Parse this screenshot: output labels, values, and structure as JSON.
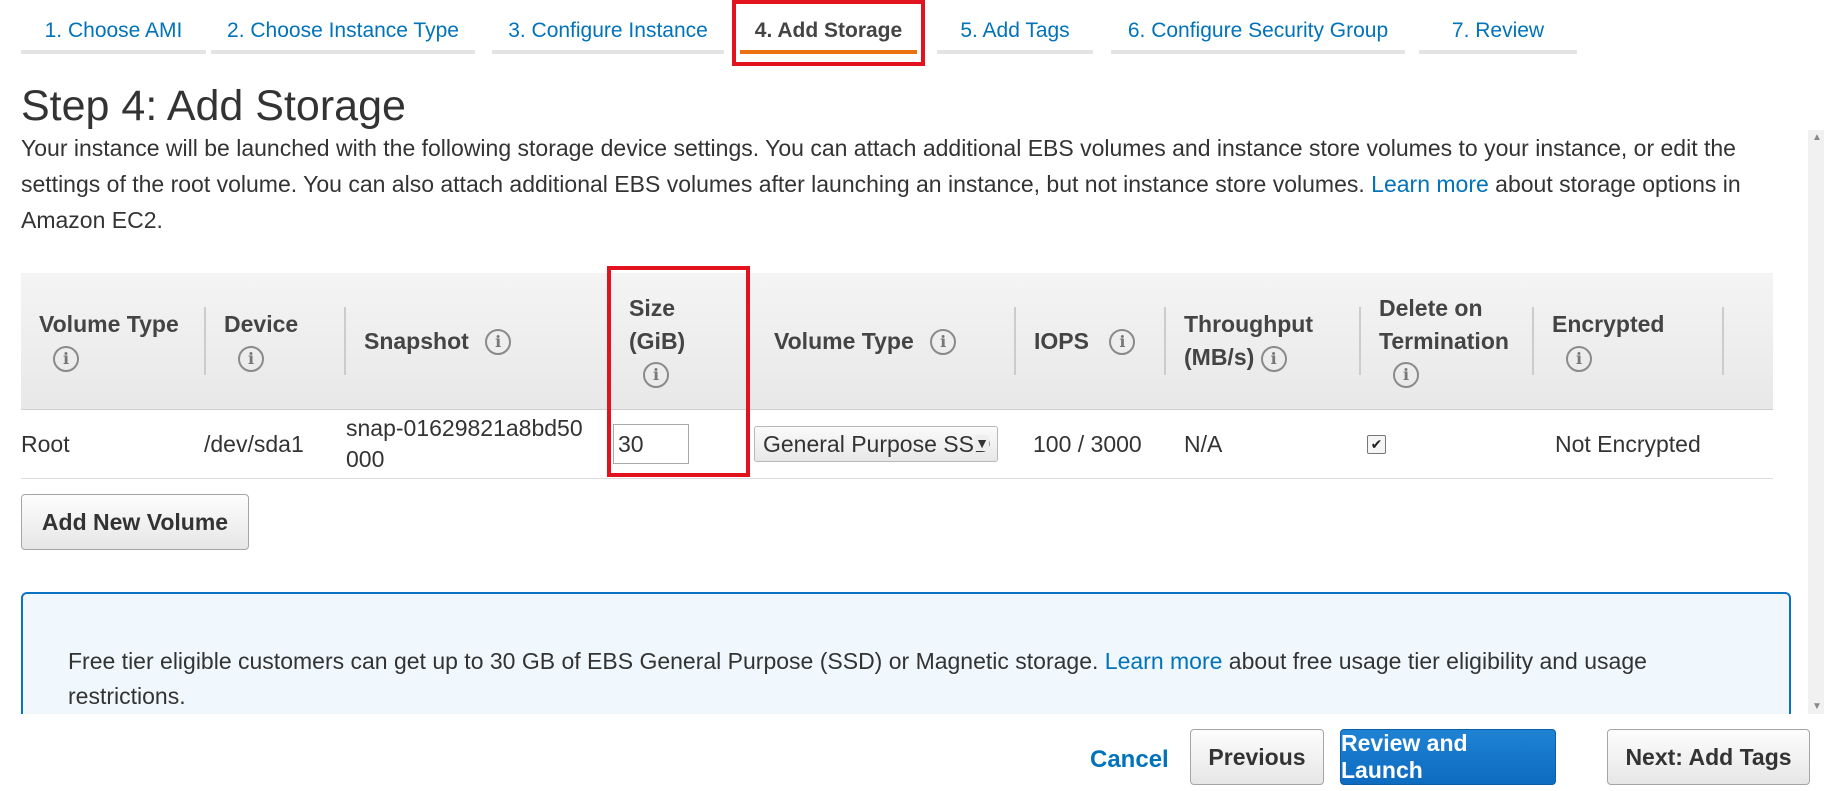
{
  "tabs": [
    {
      "label": "1. Choose AMI"
    },
    {
      "label": "2. Choose Instance Type"
    },
    {
      "label": "3. Configure Instance"
    },
    {
      "label": "4. Add Storage"
    },
    {
      "label": "5. Add Tags"
    },
    {
      "label": "6. Configure Security Group"
    },
    {
      "label": "7. Review"
    }
  ],
  "page": {
    "title": "Step 4: Add Storage",
    "description_before_link": "Your instance will be launched with the following storage device settings. You can attach additional EBS volumes and instance store volumes to your instance, or edit the settings of the root volume. You can also attach additional EBS volumes after launching an instance, but not instance store volumes.",
    "learn_more_label": "Learn more",
    "description_after_link": "about storage options in Amazon EC2."
  },
  "table": {
    "headers": {
      "volume_type": "Volume Type",
      "device": "Device",
      "snapshot": "Snapshot",
      "size": "Size (GiB)",
      "ebs_volume_type": "Volume Type",
      "iops": "IOPS",
      "throughput": "Throughput (MB/s)",
      "delete_on_termination": "Delete on Termination",
      "encrypted": "Encrypted"
    },
    "rows": [
      {
        "volume_type": "Root",
        "device": "/dev/sda1",
        "snapshot": "snap-01629821a8bd50000",
        "size": "30",
        "ebs_volume_type": "General Purpose SSD",
        "iops": "100 / 3000",
        "throughput": "N/A",
        "delete_on_termination": true,
        "encrypted": "Not Encrypted"
      }
    ]
  },
  "buttons": {
    "add_volume": "Add New Volume",
    "cancel": "Cancel",
    "previous": "Previous",
    "review_launch": "Review and Launch",
    "next": "Next: Add Tags"
  },
  "notice": {
    "text_before_link": "Free tier eligible customers can get up to 30 GB of EBS General Purpose (SSD) or Magnetic storage.",
    "learn_more_label": "Learn more",
    "text_after_link": "about free usage tier eligibility and usage restrictions."
  },
  "icons": {
    "info": "info-icon",
    "dropdown": "caret-down-icon",
    "checkbox": "check-icon"
  },
  "colors": {
    "link": "#0073bb",
    "active_tab_underline": "#ec7211",
    "primary_button": "#0d6bc0",
    "highlight": "#e3121f",
    "notice_border": "#0b73c4"
  }
}
